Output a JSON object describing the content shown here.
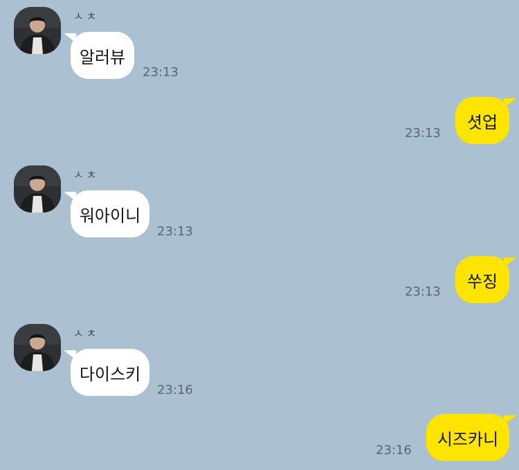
{
  "messages": [
    {
      "direction": "in",
      "sender": "ㅅㅊ",
      "text": "알러뷰",
      "time": "23:13"
    },
    {
      "direction": "out",
      "text": "셧업",
      "time": "23:13"
    },
    {
      "direction": "in",
      "sender": "ㅅㅊ",
      "text": "워아이니",
      "time": "23:13"
    },
    {
      "direction": "out",
      "text": "쑤징",
      "time": "23:13"
    },
    {
      "direction": "in",
      "sender": "ㅅㅊ",
      "text": "다이스키",
      "time": "23:16"
    },
    {
      "direction": "out",
      "text": "시즈카니",
      "time": "23:16"
    }
  ],
  "colors": {
    "background": "#abc1d1",
    "incoming_bubble": "#ffffff",
    "outgoing_bubble": "#fee500",
    "timestamp": "#5a6670"
  },
  "icons": {
    "avatar": "profile-photo-avatar"
  }
}
